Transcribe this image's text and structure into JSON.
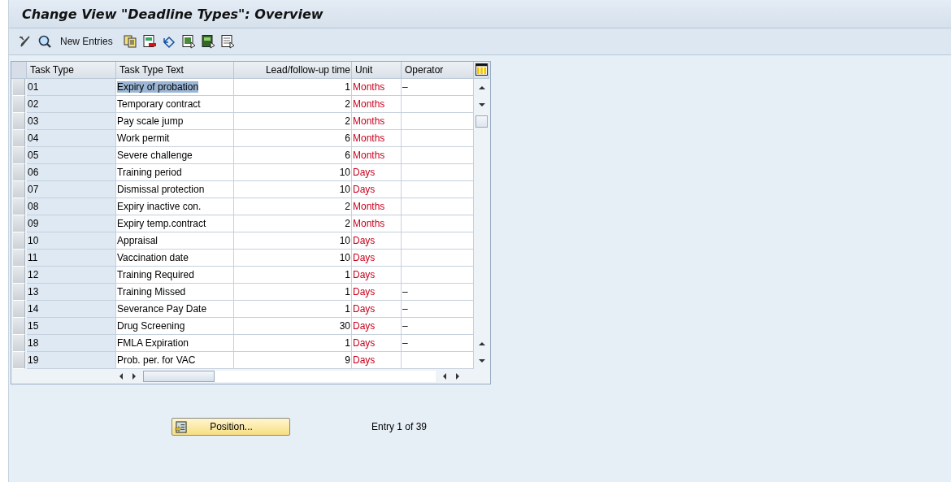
{
  "title": "Change View \"Deadline Types\": Overview",
  "toolbar": {
    "new_entries": "New Entries"
  },
  "table": {
    "columns": [
      "Task Type",
      "Task Type Text",
      "Lead/follow-up time",
      "Unit",
      "Operator"
    ],
    "rows": [
      {
        "type": "01",
        "text": "Expiry of probation",
        "time": "1",
        "unit": "Months",
        "operator": "–",
        "selected": true
      },
      {
        "type": "02",
        "text": "Temporary contract",
        "time": "2",
        "unit": "Months",
        "selected": false
      },
      {
        "type": "03",
        "text": "Pay scale jump",
        "time": "2",
        "unit": "Months",
        "selected": false
      },
      {
        "type": "04",
        "text": "Work permit",
        "time": "6",
        "unit": "Months",
        "selected": false
      },
      {
        "type": "05",
        "text": "Severe challenge",
        "time": "6",
        "unit": "Months",
        "selected": false
      },
      {
        "type": "06",
        "text": "Training period",
        "time": "10",
        "unit": "Days",
        "selected": false
      },
      {
        "type": "07",
        "text": "Dismissal protection",
        "time": "10",
        "unit": "Days",
        "selected": false
      },
      {
        "type": "08",
        "text": "Expiry inactive con.",
        "time": "2",
        "unit": "Months",
        "selected": false
      },
      {
        "type": "09",
        "text": "Expiry temp.contract",
        "time": "2",
        "unit": "Months",
        "selected": false
      },
      {
        "type": "10",
        "text": "Appraisal",
        "time": "10",
        "unit": "Days",
        "selected": false
      },
      {
        "type": "11",
        "text": "Vaccination date",
        "time": "10",
        "unit": "Days",
        "selected": false
      },
      {
        "type": "12",
        "text": "Training Required",
        "time": "1",
        "unit": "Days",
        "selected": false
      },
      {
        "type": "13",
        "text": "Training Missed",
        "time": "1",
        "unit": "Days",
        "operator": "–",
        "selected": false
      },
      {
        "type": "14",
        "text": "Severance Pay Date",
        "time": "1",
        "unit": "Days",
        "operator": "–",
        "selected": false
      },
      {
        "type": "15",
        "text": "Drug Screening",
        "time": "30",
        "unit": "Days",
        "operator": "–",
        "selected": false
      },
      {
        "type": "18",
        "text": "FMLA Expiration",
        "time": "1",
        "unit": "Days",
        "operator": "–",
        "selected": false
      },
      {
        "type": "19",
        "text": "Prob. per. for VAC",
        "time": "9",
        "unit": "Days",
        "selected": false
      }
    ]
  },
  "position_button": "Position...",
  "entry_info": "Entry 1 of 39"
}
